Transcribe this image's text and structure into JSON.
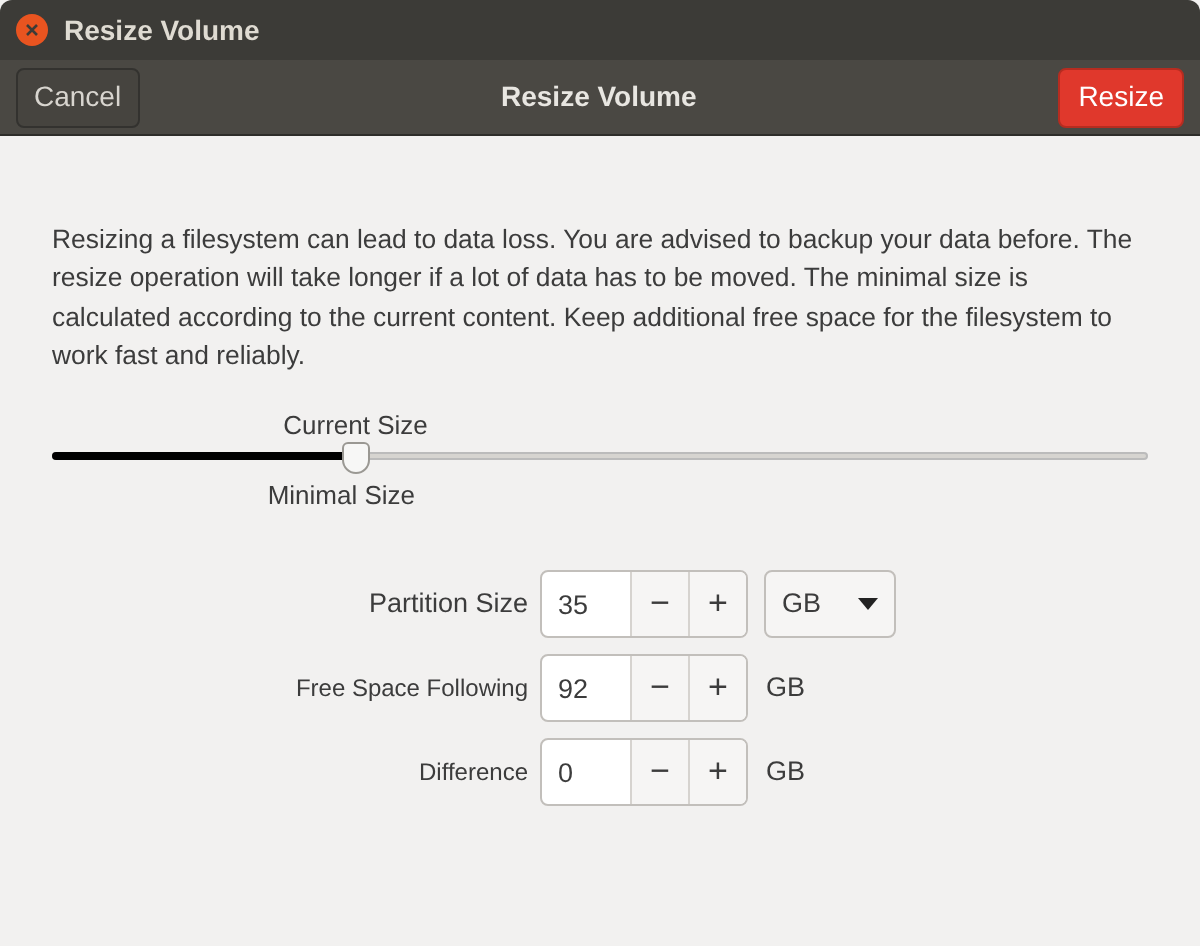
{
  "window": {
    "title": "Resize Volume"
  },
  "header_bar": {
    "cancel_button": "Cancel",
    "title": "Resize Volume",
    "resize_button": "Resize"
  },
  "description": "Resizing a filesystem can lead to data loss. You are advised to backup your data before. The resize operation will take longer if a lot of data has to be moved. The minimal size is calculated according to the current content. Keep additional free space for the filesystem to work fast and reliably.",
  "size_slider": {
    "level": 0.277,
    "current_label": "Current Size",
    "minimal_label": "Minimal Size"
  },
  "fields": [
    {
      "label": "Partition Size",
      "value": "35",
      "decrement": "−",
      "increment": "+",
      "unit": {
        "kind": "dropdown",
        "text": "GB"
      },
      "emphasis": true
    },
    {
      "label": "Free Space Following",
      "value": "92",
      "decrement": "−",
      "increment": "+",
      "unit": {
        "kind": "text",
        "text": "GB"
      },
      "emphasis": false
    },
    {
      "label": "Difference",
      "value": "0",
      "decrement": "−",
      "increment": "+",
      "unit": {
        "kind": "text",
        "text": "GB"
      },
      "emphasis": false
    }
  ]
}
